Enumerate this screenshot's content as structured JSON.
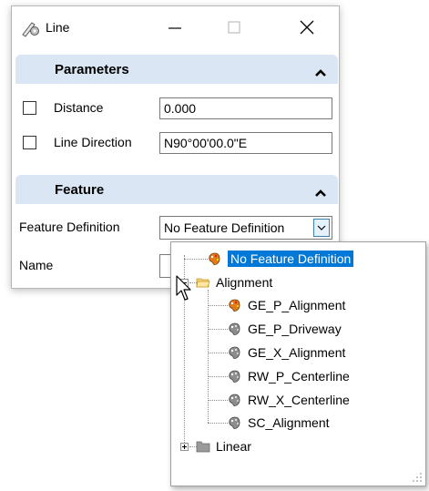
{
  "window": {
    "title": "Line",
    "icon": "line-tool-icon",
    "buttons": [
      "minimize-icon",
      "maximize-icon",
      "close-icon"
    ]
  },
  "parameters": {
    "header": "Parameters",
    "distance": {
      "label": "Distance",
      "value": "0.000",
      "checked": false
    },
    "line_direction": {
      "label": "Line Direction",
      "value": "N90°00'00.0\"E",
      "checked": false
    }
  },
  "feature": {
    "header": "Feature",
    "definition": {
      "label": "Feature Definition",
      "value": "No Feature Definition"
    },
    "name": {
      "label": "Name",
      "value": ""
    }
  },
  "dropdown_tree": {
    "items": [
      {
        "label": "No Feature Definition",
        "icon": "feature-palette-orange-icon",
        "selected": true
      },
      {
        "label": "Alignment",
        "icon": "folder-open-icon",
        "expanded": true
      },
      {
        "label": "GE_P_Alignment",
        "icon": "feature-palette-orange-icon"
      },
      {
        "label": "GE_P_Driveway",
        "icon": "feature-palette-gray-icon"
      },
      {
        "label": "GE_X_Alignment",
        "icon": "feature-palette-gray-icon"
      },
      {
        "label": "RW_P_Centerline",
        "icon": "feature-palette-gray-icon"
      },
      {
        "label": "RW_X_Centerline",
        "icon": "feature-palette-gray-icon"
      },
      {
        "label": "SC_Alignment",
        "icon": "feature-palette-gray-icon"
      },
      {
        "label": "Linear",
        "icon": "folder-closed-icon",
        "expanded": false
      }
    ]
  },
  "colors": {
    "section_header": "#dbe6f4",
    "selection": "#0078d7",
    "dropdown_button": "#e5f1fb"
  }
}
